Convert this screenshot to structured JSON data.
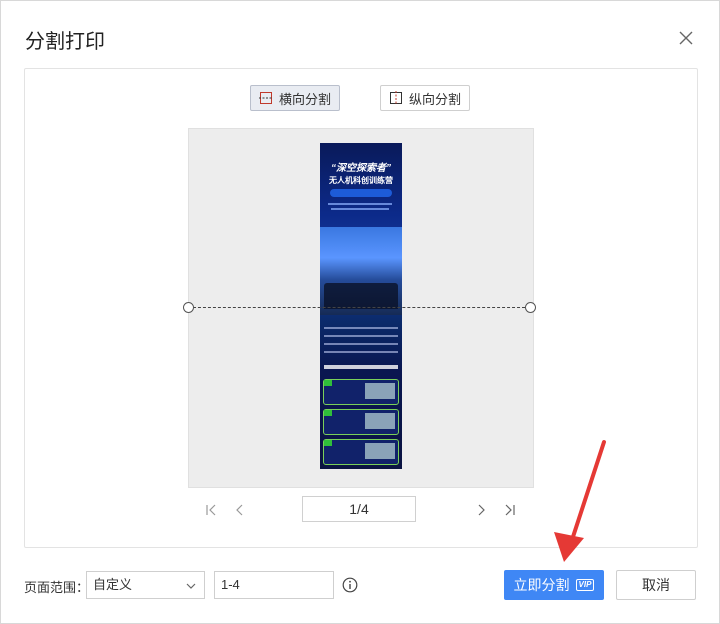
{
  "dialog": {
    "title": "分割打印"
  },
  "split_modes": [
    {
      "label": "横向分割",
      "icon": "horizontal-split-icon",
      "active": true
    },
    {
      "label": "纵向分割",
      "icon": "vertical-split-icon",
      "active": false
    }
  ],
  "preview": {
    "poster_title": "“深空探索者”",
    "poster_subtitle": "无人机科创训练营"
  },
  "pager": {
    "current": "1/4"
  },
  "footer": {
    "range_label": "页面范围：",
    "range_mode": "自定义",
    "range_value": "1-4",
    "split_button": "立即分割",
    "vip_badge": "VIP",
    "cancel_button": "取消"
  },
  "colors": {
    "primary": "#3f87f5",
    "annotation_arrow": "#e53935"
  }
}
